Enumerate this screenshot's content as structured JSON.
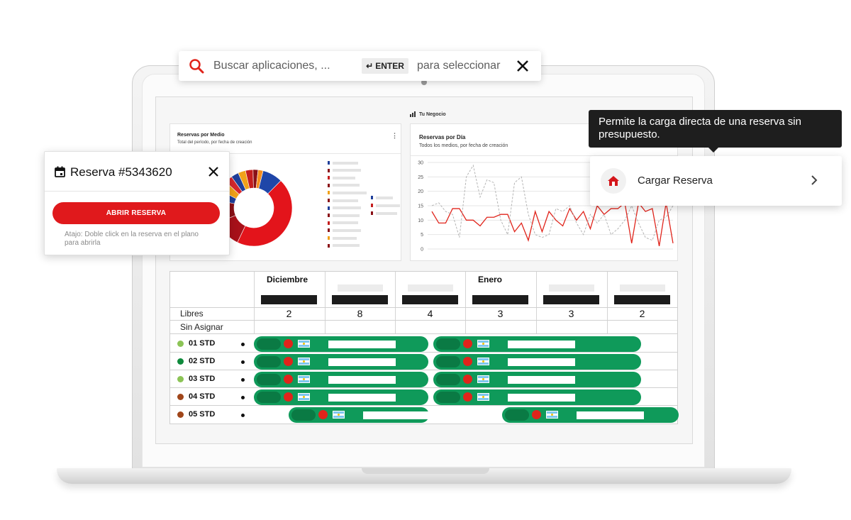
{
  "search": {
    "placeholder": "Buscar aplicaciones, ...",
    "enter_key": "ENTER",
    "enter_glyph": "↵",
    "hint": "para seleccionar",
    "icons": {
      "search": "search-icon",
      "close": "close-icon"
    }
  },
  "dashboard": {
    "brand": "Tu Negocio",
    "donut_card": {
      "title": "Reservas por Medio",
      "subtitle": "Total del período, por fecha de creación",
      "kebab": "⋮"
    },
    "line_card": {
      "title": "Reservas por Día",
      "subtitle": "Todos los medios, por fecha de creación"
    }
  },
  "chart_data": [
    {
      "type": "pie",
      "title": "Reservas por Medio",
      "subtitle": "Total del período, por fecha de creación",
      "slices": [
        {
          "value": 42,
          "color": "#e3141b"
        },
        {
          "value": 11,
          "color": "#a8111a"
        },
        {
          "value": 9,
          "color": "#8a1016"
        },
        {
          "value": 4,
          "color": "#1f3f9a"
        },
        {
          "value": 4,
          "color": "#f1a21a"
        },
        {
          "value": 3,
          "color": "#d6272d"
        },
        {
          "value": 3,
          "color": "#1f3f9a"
        },
        {
          "value": 3,
          "color": "#f1a21a"
        },
        {
          "value": 3,
          "color": "#c41d1d"
        },
        {
          "value": 2,
          "color": "#8a1016"
        },
        {
          "value": 2,
          "color": "#f58d1e"
        },
        {
          "value": 8,
          "color": "#1f46a8"
        }
      ]
    },
    {
      "type": "line",
      "title": "Reservas por Día",
      "subtitle": "Todos los medios, por fecha de creación",
      "ylim": [
        0,
        30
      ],
      "yticks": [
        0,
        5,
        10,
        15,
        20,
        25,
        30
      ],
      "grid": true,
      "series": [
        {
          "style": "solid",
          "color": "#e0241b",
          "values": [
            13,
            9,
            9,
            14,
            14,
            10,
            10,
            8,
            11,
            11,
            12,
            12,
            6,
            9,
            3,
            13,
            6,
            13,
            10,
            8,
            14,
            10,
            13,
            7,
            15,
            12,
            14,
            14,
            16,
            2,
            16,
            13,
            14,
            1,
            16,
            2
          ]
        },
        {
          "style": "dashed",
          "color": "#b5b5b5",
          "values": [
            15,
            16,
            13,
            12,
            4,
            25,
            29,
            18,
            24,
            23,
            10,
            5,
            23,
            25,
            12,
            5,
            4,
            5,
            14,
            13,
            15,
            9,
            5,
            12,
            9,
            12,
            5,
            7,
            10,
            15,
            9,
            4,
            3,
            10,
            11,
            15
          ]
        }
      ]
    }
  ],
  "calendar": {
    "months": [
      {
        "label": "Diciembre"
      },
      {
        "label": ""
      },
      {
        "label": ""
      },
      {
        "label": "Enero"
      },
      {
        "label": ""
      },
      {
        "label": ""
      }
    ],
    "libres_label": "Libres",
    "sin_asignar_label": "Sin Asignar",
    "libres_counts": [
      "2",
      "8",
      "4",
      "3",
      "3",
      "2"
    ],
    "rooms": [
      {
        "name": "01 STD",
        "status_color": "#8cc456"
      },
      {
        "name": "02 STD",
        "status_color": "#0f8a3c"
      },
      {
        "name": "03 STD",
        "status_color": "#8cc456"
      },
      {
        "name": "04 STD",
        "status_color": "#a0461a"
      },
      {
        "name": "05 STD",
        "status_color": "#a0461a"
      }
    ]
  },
  "reserva_popup": {
    "title": "Reserva #5343620",
    "button": "ABRIR RESERVA",
    "hint": "Atajo: Doble click en la reserva en el plano para abrirla",
    "icons": {
      "calendar": "calendar-icon",
      "close": "close-icon"
    }
  },
  "tooltip": {
    "text": "Permite la carga directa de una reserva sin presupuesto."
  },
  "cargar": {
    "label": "Cargar Reserva",
    "icons": {
      "home": "home-icon",
      "chevron": "chevron-right-icon"
    }
  }
}
